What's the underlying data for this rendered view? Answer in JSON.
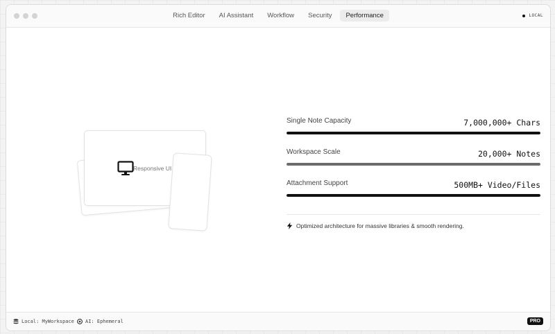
{
  "window": {
    "tabs": [
      {
        "label": "Rich Editor",
        "active": false
      },
      {
        "label": "AI Assistant",
        "active": false
      },
      {
        "label": "Workflow",
        "active": false
      },
      {
        "label": "Security",
        "active": false
      },
      {
        "label": "Performance",
        "active": true
      }
    ],
    "status": "LOCAL"
  },
  "illustration": {
    "label": "Responsive UI",
    "icon": "monitor-icon"
  },
  "metrics": [
    {
      "label": "Single Note Capacity",
      "value": "7,000,000+ Chars",
      "fill_percent": 100,
      "color": "#111111"
    },
    {
      "label": "Workspace Scale",
      "value": "20,000+ Notes",
      "fill_percent": 100,
      "color": "#6b6b6b"
    },
    {
      "label": "Attachment Support",
      "value": "500MB+ Video/Files",
      "fill_percent": 100,
      "color": "#111111"
    }
  ],
  "note": {
    "icon": "bolt-icon",
    "text": "Optimized architecture for massive libraries & smooth rendering."
  },
  "footer": {
    "workspace": "Local: MyWorkspace",
    "ai": "AI: Ephemeral",
    "badge": "PRO"
  }
}
